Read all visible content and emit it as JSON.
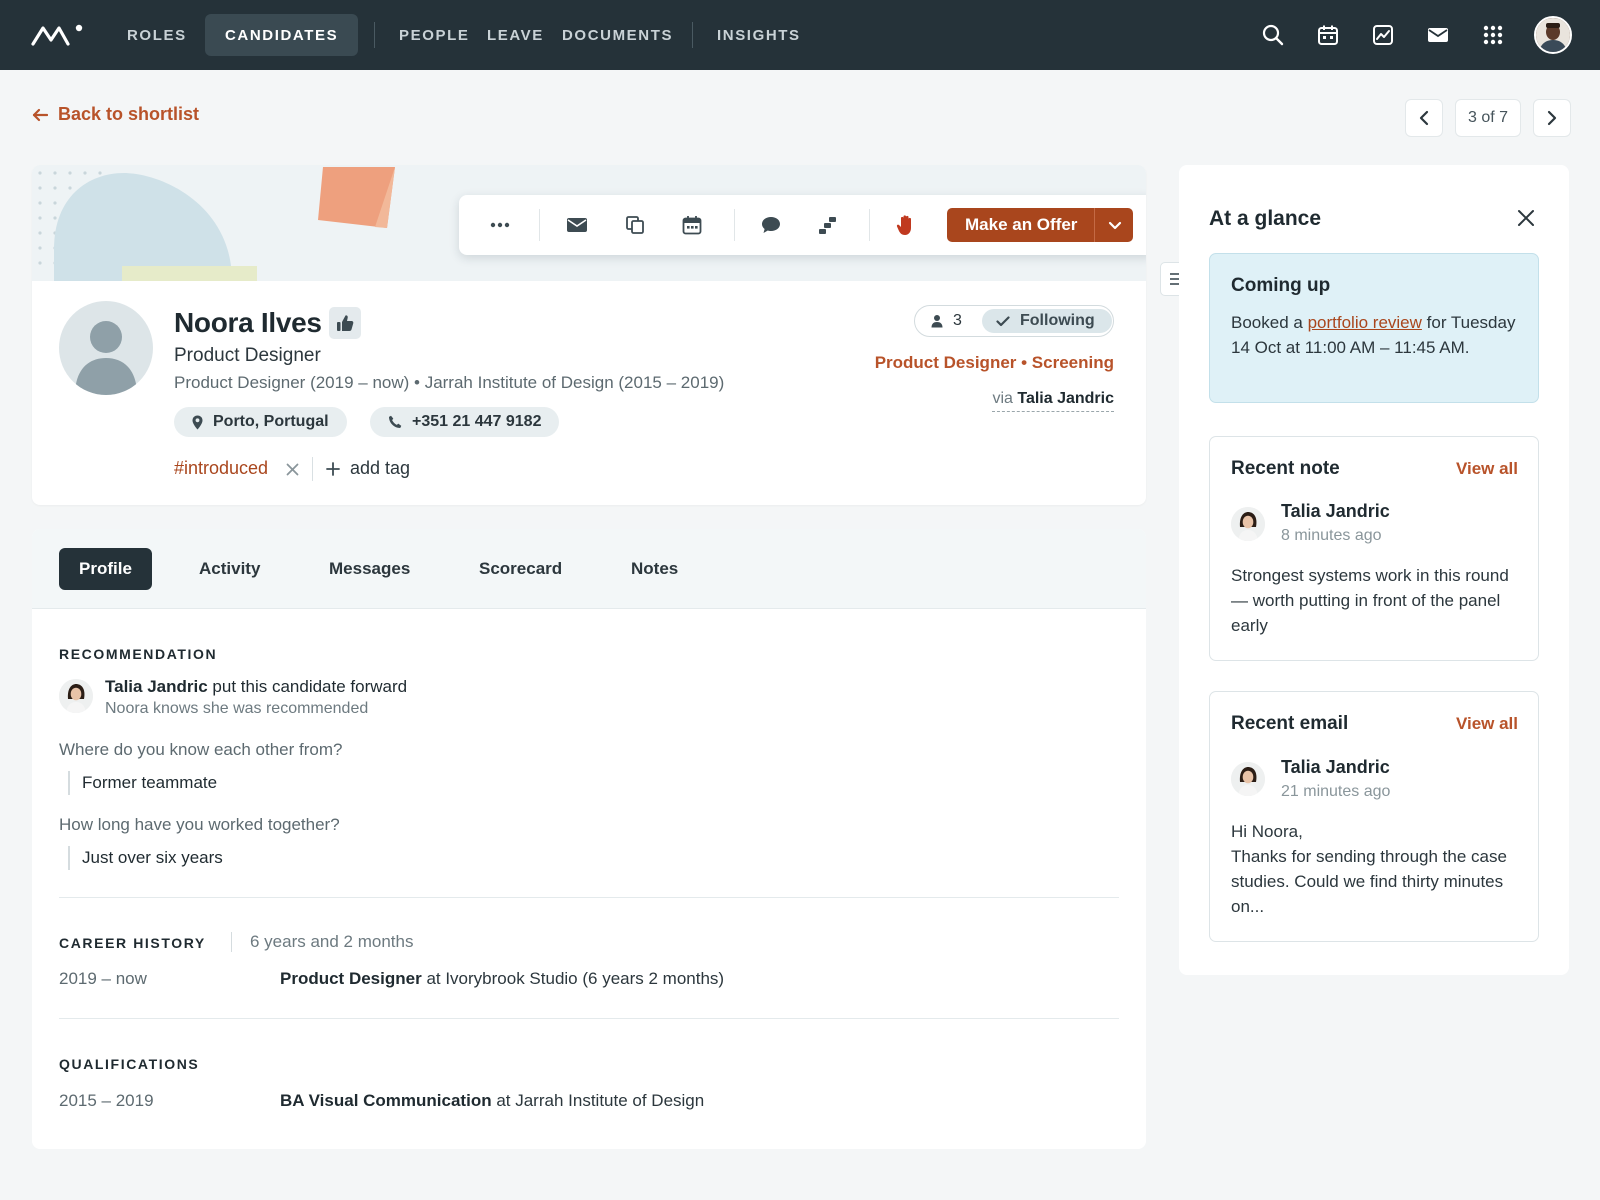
{
  "nav": {
    "roles": "ROLES",
    "candidates": "CANDIDATES",
    "people": "PEOPLE",
    "leave": "LEAVE",
    "documents": "DOCUMENTS",
    "insights": "INSIGHTS",
    "icons": [
      "search-icon",
      "calendar-icon",
      "chart-icon",
      "mail-icon",
      "apps-grid-icon"
    ]
  },
  "back": {
    "label": "Back to shortlist"
  },
  "pager": {
    "label": "3 of 7"
  },
  "actions": {
    "icons": [
      "more-icon",
      "email-icon",
      "copy-icon",
      "calendar-icon",
      "comment-icon",
      "move-stage-icon",
      "stop-hand-icon"
    ],
    "offer_label": "Make an Offer"
  },
  "candidate": {
    "name": "Noora Ilves",
    "title": "Product Designer",
    "meta": "Product Designer (2019 – now) • Jarrah Institute of Design (2015 – 2019)",
    "location": "Porto, Portugal",
    "phone": "+351 21 447 9182",
    "tag": "#introduced",
    "add_tag": "add tag",
    "followers": "3",
    "following_label": "Following",
    "stage": "Product Designer • Screening",
    "via_prefix": "via",
    "via_name": "Talia Jandric"
  },
  "tabs": [
    "Profile",
    "Activity",
    "Messages",
    "Scorecard",
    "Notes"
  ],
  "recommendation": {
    "heading": "RECOMMENDATION",
    "recommender": "Talia Jandric",
    "action": "put this candidate forward",
    "note": "Noora knows she was recommended",
    "q1": "Where do you know each other from?",
    "a1": "Former teammate",
    "q2": "How long have you worked together?",
    "a2": "Just over six years"
  },
  "career": {
    "heading": "CAREER HISTORY",
    "duration": "6 years and 2 months",
    "date": "2019 – now",
    "role": "Product Designer",
    "rest": "at Ivorybrook Studio (6 years 2 months)"
  },
  "qualifications": {
    "heading": "QUALIFICATIONS",
    "date": "2015 – 2019",
    "degree": "BA Visual Communication",
    "rest": "at Jarrah Institute of Design"
  },
  "panel": {
    "title": "At a glance",
    "coming_up": {
      "heading": "Coming up",
      "pre": "Booked a",
      "link": "portfolio review",
      "post": "for Tuesday 14 Oct at 11:00 AM – 11:45 AM."
    },
    "note": {
      "heading": "Recent note",
      "view_all": "View all",
      "author": "Talia Jandric",
      "time": "8 minutes ago",
      "body": "Strongest systems work in this round — worth putting in front of the panel early"
    },
    "email": {
      "heading": "Recent email",
      "view_all": "View all",
      "author": "Talia Jandric",
      "time": "21 minutes ago",
      "greeting": "Hi Noora,",
      "body": "Thanks for sending through the case studies. Could we find thirty minutes on..."
    }
  },
  "colors": {
    "nav_bg": "#253239",
    "accent": "#a9461d",
    "accent_text": "#b8532a",
    "info_bg": "#dff1f7"
  }
}
